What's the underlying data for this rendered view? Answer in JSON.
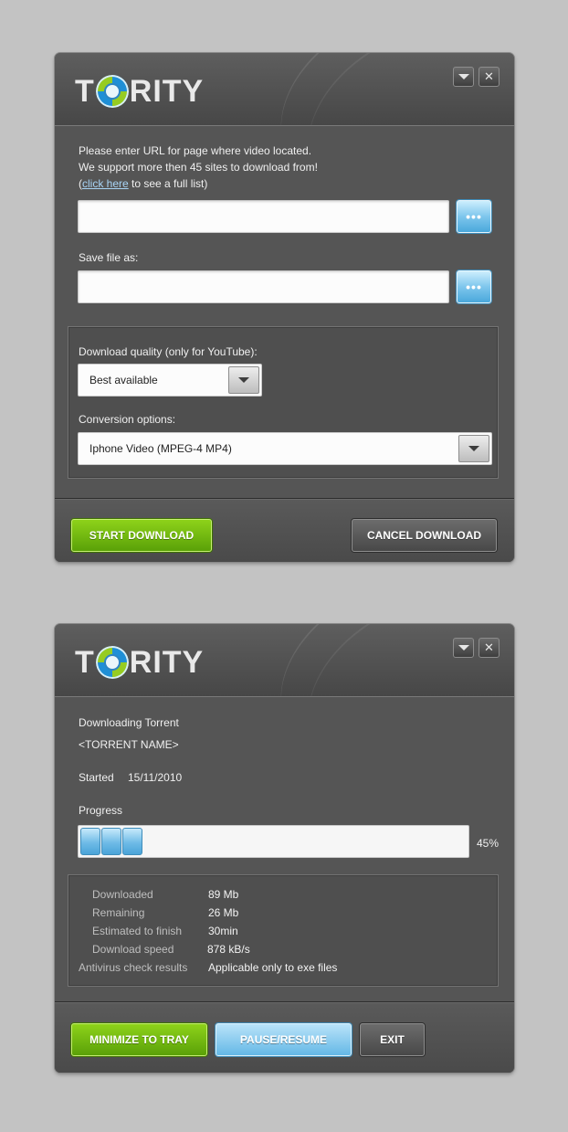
{
  "app": {
    "name_prefix": "T",
    "name_suffix": "RITY"
  },
  "colors": {
    "background": "#c3c3c3",
    "window": "#555555",
    "accent_green": "#7bc012",
    "accent_blue": "#6fbbe7",
    "link": "#a8d4f5"
  },
  "window_controls": {
    "minimize_icon": "chevron-down",
    "close_icon": "close-x",
    "close_glyph": "✕"
  },
  "download_form": {
    "instructions_line1": "Please enter URL for page where video located.",
    "instructions_line2": "We support more then 45 sites to download from!",
    "paren_open": "(",
    "link_text": "click here",
    "link_suffix": " to see a full list)",
    "url_value": "",
    "browse_label": "•••",
    "save_label": "Save file as:",
    "save_value": "",
    "quality_label": "Download quality (only for YouTube):",
    "quality_value": "Best available",
    "conversion_label": "Conversion options:",
    "conversion_value": "Iphone Video (MPEG-4 MP4)",
    "start_button": "START DOWNLOAD",
    "cancel_button": "CANCEL DOWNLOAD"
  },
  "progress_window": {
    "title": "Downloading Torrent",
    "torrent_name": "<TORRENT NAME>",
    "started_label": "Started",
    "started_value": "15/11/2010",
    "progress_label": "Progress",
    "progress_percent": 45,
    "progress_text": "45%",
    "stats": [
      {
        "label": "Downloaded",
        "value": "89 Mb"
      },
      {
        "label": "Remaining",
        "value": "26 Mb"
      },
      {
        "label": "Estimated to finish",
        "value": "30min"
      },
      {
        "label": "Download speed",
        "value": "878 kB/s"
      },
      {
        "label": "Antivirus check results",
        "value": "Applicable only to exe files"
      }
    ],
    "minimize_button": "MINIMIZE TO TRAY",
    "pause_button": "PAUSE/RESUME",
    "exit_button": "EXIT"
  }
}
